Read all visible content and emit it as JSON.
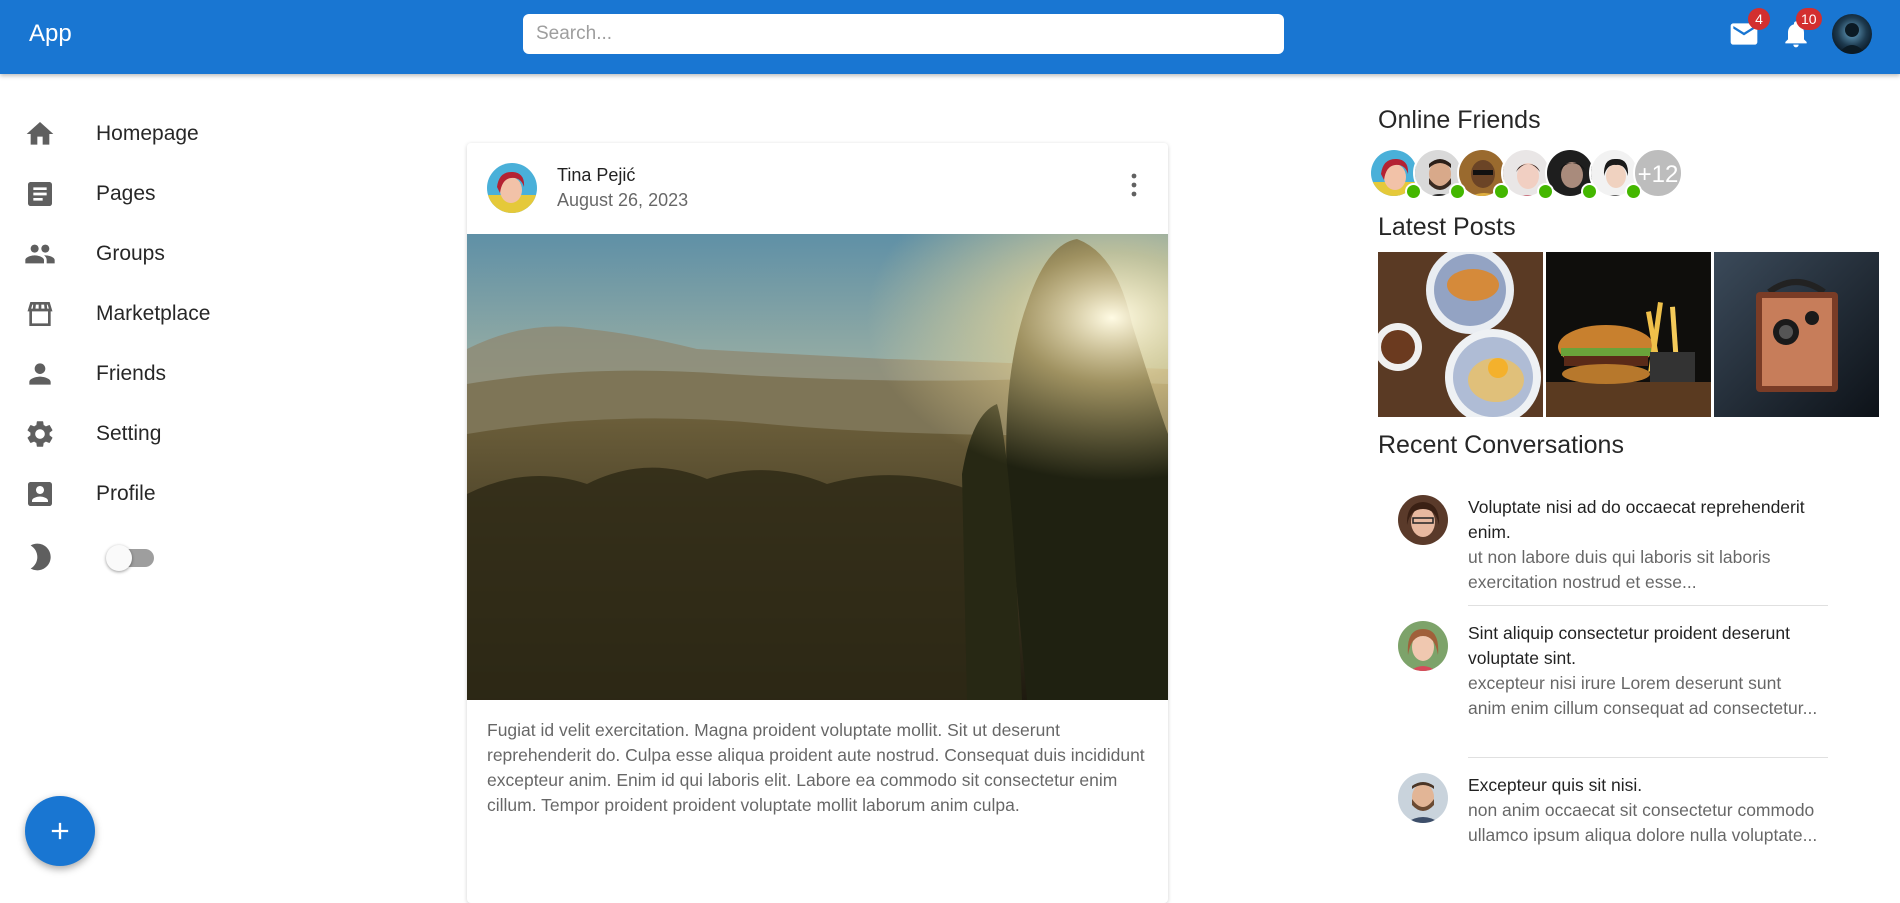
{
  "app": {
    "title": "App"
  },
  "search": {
    "placeholder": "Search..."
  },
  "header": {
    "mail_badge": "4",
    "notifications_badge": "10"
  },
  "sidebar": {
    "items": [
      {
        "label": "Homepage",
        "icon": "home-icon"
      },
      {
        "label": "Pages",
        "icon": "article-icon"
      },
      {
        "label": "Groups",
        "icon": "group-icon"
      },
      {
        "label": "Marketplace",
        "icon": "storefront-icon"
      },
      {
        "label": "Friends",
        "icon": "person-icon"
      },
      {
        "label": "Setting",
        "icon": "settings-icon"
      },
      {
        "label": "Profile",
        "icon": "account-box-icon"
      }
    ],
    "dark_mode_enabled": false
  },
  "post": {
    "author": "Tina Pejić",
    "date": "August 26, 2023",
    "body": "Fugiat id velit exercitation. Magna proident voluptate mollit. Sit ut deserunt reprehenderit do. Culpa esse aliqua proident aute nostrud. Consequat duis incididunt excepteur anim. Enim id qui laboris elit. Labore ea commodo sit consectetur enim cillum. Tempor proident proident voluptate mollit laborum anim culpa."
  },
  "right": {
    "online_title": "Online Friends",
    "online_more": "+12",
    "latest_title": "Latest Posts",
    "recent_title": "Recent Conversations",
    "conversations": [
      {
        "title": "Voluptate nisi ad do occaecat reprehenderit enim.",
        "preview": "ut non labore duis qui laboris sit laboris exercitation nostrud et esse..."
      },
      {
        "title": "Sint aliquip consectetur proident deserunt voluptate sint.",
        "preview": "excepteur nisi irure Lorem deserunt sunt anim enim cillum consequat ad consectetur..."
      },
      {
        "title": "Excepteur quis sit nisi.",
        "preview": "non anim occaecat sit consectetur commodo ullamco ipsum aliqua dolore nulla voluptate..."
      }
    ]
  },
  "colors": {
    "primary": "#1976d2",
    "badge": "#d32f2f",
    "online": "#44b700"
  }
}
